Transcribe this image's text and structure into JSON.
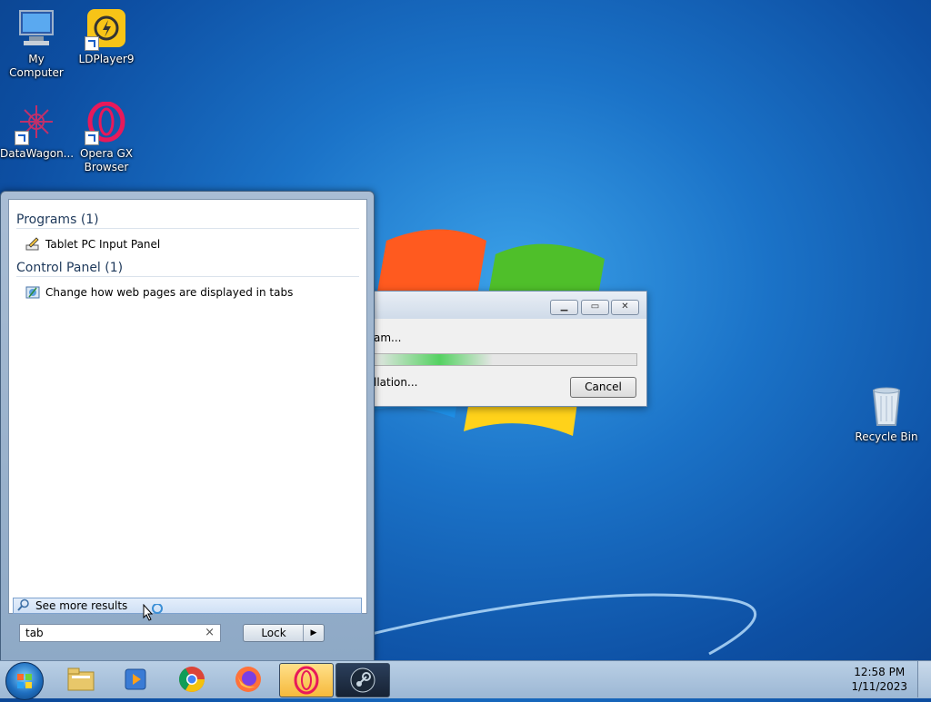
{
  "desktop": {
    "icons": [
      {
        "label": "My Computer"
      },
      {
        "label": "LDPlayer9"
      },
      {
        "label": "DataWagon..."
      },
      {
        "label": "Opera GX Browser"
      },
      {
        "label": "Recycle Bin"
      }
    ]
  },
  "dialog": {
    "message_top": "am...",
    "message_bottom": "llation...",
    "progress_fraction": 0.45,
    "cancel_label": "Cancel"
  },
  "start_menu": {
    "sections": [
      {
        "heading": "Programs (1)",
        "items": [
          {
            "label": "Tablet PC Input Panel",
            "icon": "tablet-pen-icon"
          }
        ]
      },
      {
        "heading": "Control Panel (1)",
        "items": [
          {
            "label": "Change how web pages are displayed in tabs",
            "icon": "control-panel-icon"
          }
        ]
      }
    ],
    "see_more_label": "See more results",
    "search_value": "tab",
    "clear_glyph": "×",
    "power_label": "Lock",
    "power_arrow": "▶"
  },
  "taskbar": {
    "pinned": [
      "file-explorer-icon",
      "media-player-icon",
      "chrome-icon",
      "firefox-icon",
      "opera-gx-icon",
      "steam-icon"
    ],
    "time": "12:58 PM",
    "date": "1/11/2023"
  }
}
